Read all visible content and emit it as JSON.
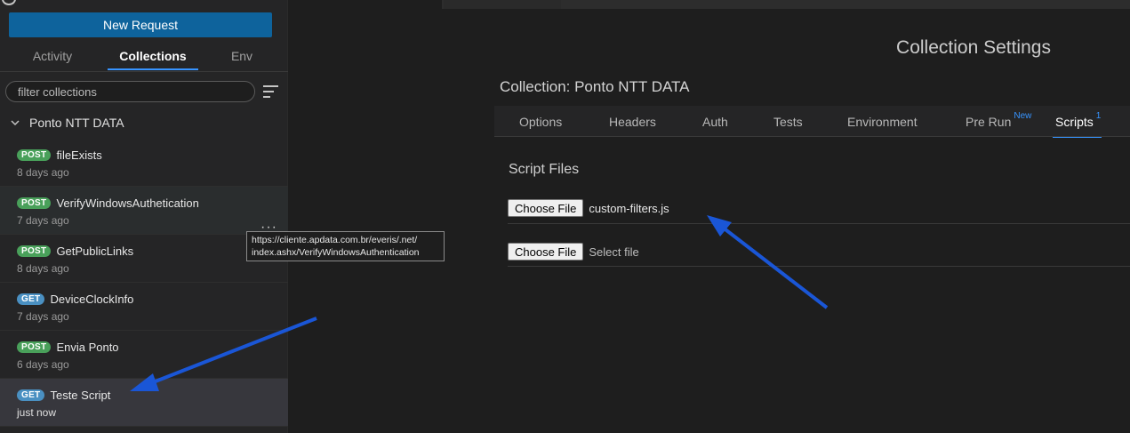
{
  "sidebar": {
    "new_request_label": "New Request",
    "tabs": [
      {
        "label": "Activity",
        "active": false
      },
      {
        "label": "Collections",
        "active": true
      },
      {
        "label": "Env",
        "active": false
      }
    ],
    "filter_placeholder": "filter collections",
    "collection": {
      "name": "Ponto NTT DATA",
      "requests": [
        {
          "method": "POST",
          "name": "fileExists",
          "time": "8 days ago"
        },
        {
          "method": "POST",
          "name": "VerifyWindowsAuthetication",
          "time": "7 days ago"
        },
        {
          "method": "POST",
          "name": "GetPublicLinks",
          "time": "8 days ago"
        },
        {
          "method": "GET",
          "name": "DeviceClockInfo",
          "time": "7 days ago"
        },
        {
          "method": "POST",
          "name": "Envia Ponto",
          "time": "6 days ago"
        },
        {
          "method": "GET",
          "name": "Teste Script",
          "time": "just now"
        }
      ]
    },
    "tooltip": {
      "line1": "https://cliente.apdata.com.br/everis/.net/",
      "line2": "index.ashx/VerifyWindowsAuthentication"
    },
    "more_glyph": "···"
  },
  "main": {
    "page_title": "Collection Settings",
    "collection_label": "Collection: Ponto NTT DATA",
    "tabs": [
      {
        "label": "Options",
        "badge": ""
      },
      {
        "label": "Headers",
        "badge": ""
      },
      {
        "label": "Auth",
        "badge": ""
      },
      {
        "label": "Tests",
        "badge": ""
      },
      {
        "label": "Environment",
        "badge": ""
      },
      {
        "label": "Pre Run",
        "badge": "New"
      },
      {
        "label": "Scripts",
        "badge": "1"
      }
    ],
    "active_tab": "Scripts",
    "script_files_label": "Script Files",
    "files": [
      {
        "button": "Choose File",
        "value": "custom-filters.js"
      },
      {
        "button": "Choose File",
        "value": "Select file"
      }
    ]
  },
  "colors": {
    "accent": "#0e639c",
    "post": "#49a05a",
    "get": "#4a90c2",
    "annotation_arrow": "#1a56d6"
  }
}
